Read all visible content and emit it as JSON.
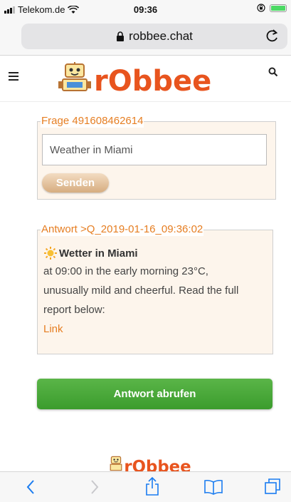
{
  "status_bar": {
    "carrier": "Telekom.de",
    "time": "09:36"
  },
  "browser": {
    "url": "robbee.chat"
  },
  "header": {
    "logo_text": "rObbee",
    "icons": [
      "menu-icon",
      "search-icon"
    ]
  },
  "question": {
    "legend": "Frage 491608462614",
    "input_value": "Weather in Miami",
    "send_label": "Senden"
  },
  "answer": {
    "legend": "Antwort >Q_2019-01-16_09:36:02",
    "title": "Wetter in Miami",
    "lines": [
      "at 09:00 in the early morning 23°C,",
      "unusually mild and cheerful. Read the full",
      "report below:"
    ],
    "link_label": "Link"
  },
  "fetch_button": {
    "label": "Antwort abrufen"
  },
  "colors": {
    "accent_orange": "#e67e22",
    "button_green": "#3b9c2d",
    "box_background": "#fdf5ec"
  }
}
